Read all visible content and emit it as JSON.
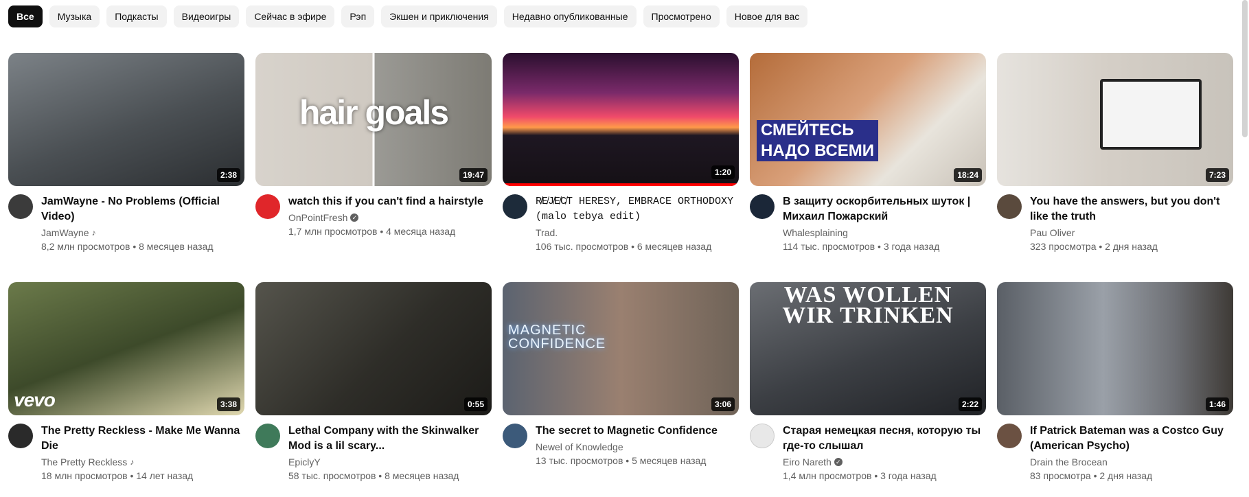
{
  "chips": [
    "Все",
    "Музыка",
    "Подкасты",
    "Видеоигры",
    "Сейчас в эфире",
    "Рэп",
    "Экшен и приключения",
    "Недавно опубликованные",
    "Просмотрено",
    "Новое для вас"
  ],
  "videos": [
    {
      "title": "JamWayne - No Problems (Official Video)",
      "channel": "JamWayne",
      "stats": "8,2 млн просмотров • 8 месяцев назад",
      "duration": "2:38",
      "badge": "note",
      "thumb_text": "",
      "bg": "#5d6368",
      "avatar_color": "#3b3b3b"
    },
    {
      "title": "watch this if you can't find a hairstyle",
      "channel": "OnPointFresh",
      "stats": "1,7 млн просмотров • 4 месяца назад",
      "duration": "19:47",
      "badge": "verified",
      "thumb_text": "hair goals",
      "bg": "#cfcac4",
      "avatar_color": "#e0262a"
    },
    {
      "title": "R̸E̸J̸E̸C̸T HERESY, EMBRACE ORTHODOXY (malo tebya edit)",
      "channel": "Trad.",
      "stats": "106 тыс. просмотров • 6 месяцев назад",
      "duration": "1:20",
      "badge": "",
      "thumb_text": "",
      "bg": "#2a1a3a",
      "avatar_color": "#1d2b3a"
    },
    {
      "title": "В защиту оскорбительных шуток | Михаил Пожарский",
      "channel": "Whalesplaining",
      "stats": "114 тыс. просмотров • 3 года назад",
      "duration": "18:24",
      "badge": "",
      "thumb_text": "СМЕЙТЕСЬ\nНАДО ВСЕМИ",
      "bg": "#c98a5a",
      "avatar_color": "#1b2738"
    },
    {
      "title": "You have the answers, but you don't like the truth",
      "channel": "Pau Oliver",
      "stats": "323 просмотра • 2 дня назад",
      "duration": "7:23",
      "badge": "",
      "thumb_text": "",
      "bg": "#d9d6d1",
      "avatar_color": "#5a4a3d"
    },
    {
      "title": "The Pretty Reckless - Make Me Wanna Die",
      "channel": "The Pretty Reckless",
      "stats": "18 млн просмотров • 14 лет назад",
      "duration": "3:38",
      "badge": "note",
      "thumb_text": "vevo",
      "bg": "#3e4a2e",
      "avatar_color": "#2a2a2a"
    },
    {
      "title": "Lethal Company with the Skinwalker Mod is a lil scary...",
      "channel": "EpiclyY",
      "stats": "58 тыс. просмотров • 8 месяцев назад",
      "duration": "0:55",
      "badge": "",
      "thumb_text": "",
      "bg": "#3a3a36",
      "avatar_color": "#3f7a5a"
    },
    {
      "title": "The secret to Magnetic Confidence",
      "channel": "Newel of Knowledge",
      "stats": "13 тыс. просмотров • 5 месяцев назад",
      "duration": "3:06",
      "badge": "",
      "thumb_text": "MAGNETIC CONFIDENCE",
      "bg": "#8a6f5c",
      "avatar_color": "#3c5a7a"
    },
    {
      "title": "Старая немецкая песня, которую ты где-то слышал",
      "channel": "Eiro Nareth",
      "stats": "1,4 млн просмотров • 3 года назад",
      "duration": "2:22",
      "badge": "verified",
      "thumb_text": "WAS WOLLEN WIR TRINKEN",
      "bg": "#4a4d52",
      "avatar_color": "#e8e8e8"
    },
    {
      "title": "If Patrick Bateman was a Costco Guy (American Psycho)",
      "channel": "Drain the Brocean",
      "stats": "83 просмотра • 2 дня назад",
      "duration": "1:46",
      "badge": "",
      "thumb_text": "",
      "bg": "#7b7f86",
      "avatar_color": "#6b5142"
    }
  ]
}
